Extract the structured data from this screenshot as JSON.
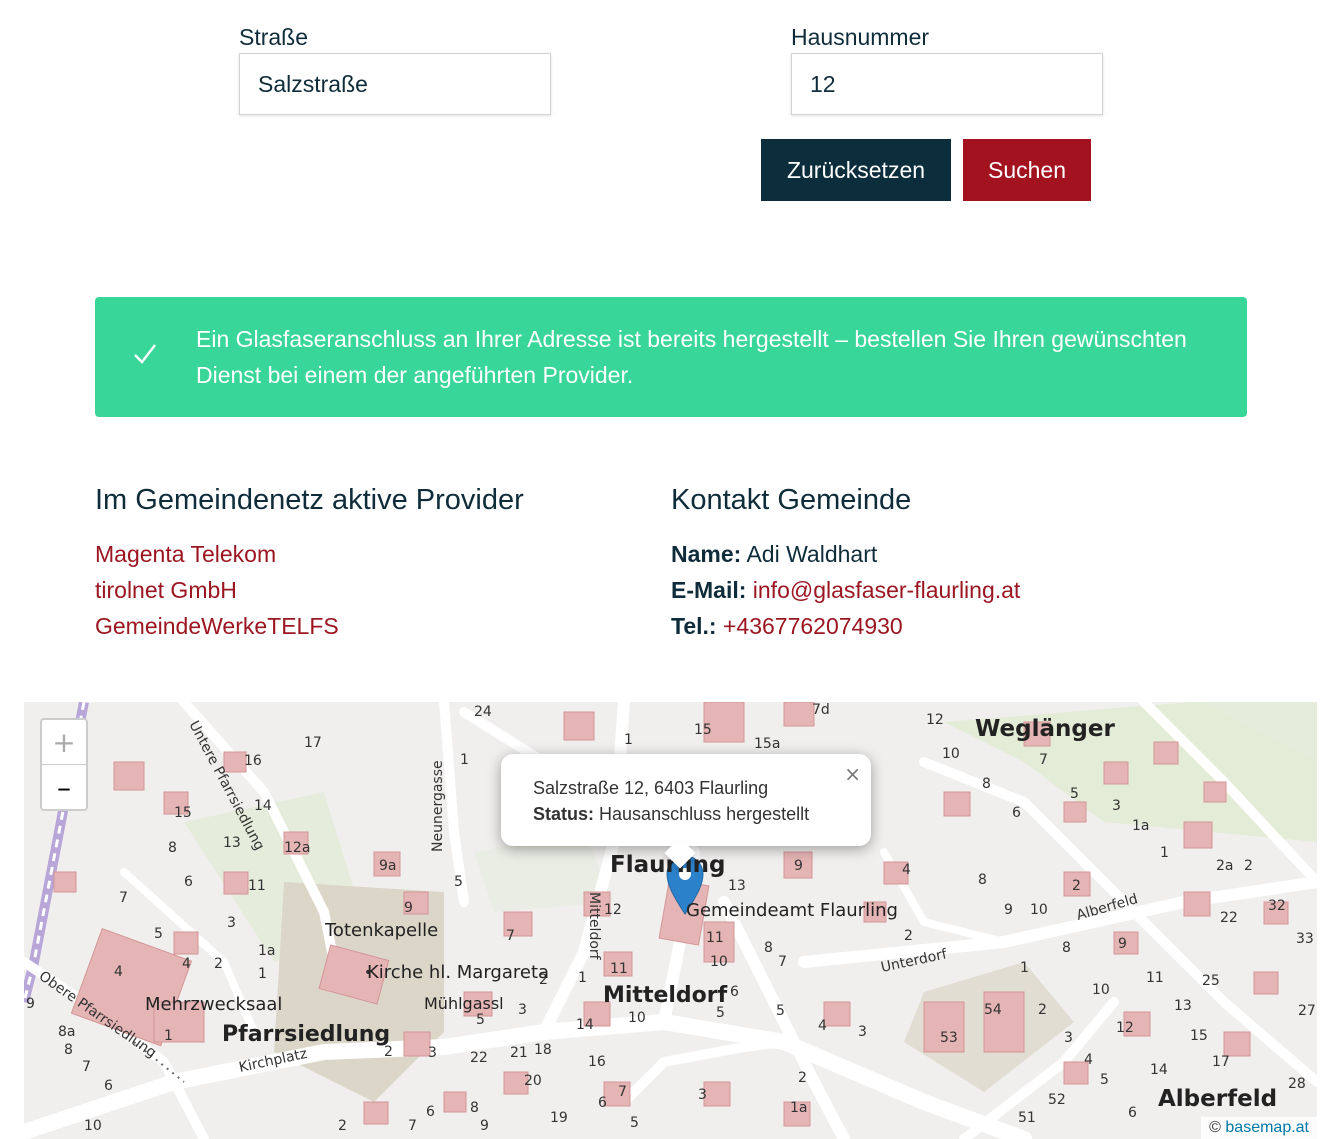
{
  "form": {
    "street_label": "Straße",
    "street_value": "Salzstraße",
    "number_label": "Hausnummer",
    "number_value": "12",
    "reset_label": "Zurücksetzen",
    "search_label": "Suchen"
  },
  "alert": {
    "icon": "check-icon",
    "text": "Ein Glasfaseranschluss an Ihrer Adresse ist bereits hergestellt – bestellen Sie Ihren gewünschten Dienst bei einem der angeführten Provider.",
    "color": "#38d698"
  },
  "providers": {
    "title": "Im Gemeindenetz aktive Provider",
    "items": [
      "Magenta Telekom",
      "tirolnet GmbH",
      "GemeindeWerkeTELFS"
    ]
  },
  "contact": {
    "title": "Kontakt Gemeinde",
    "name_label": "Name:",
    "name_value": "Adi Waldhart",
    "email_label": "E-Mail:",
    "email_value": "info@glasfaser-flaurling.at",
    "tel_label": "Tel.:",
    "tel_value": "+4367762074930"
  },
  "map": {
    "zoom_in": "+",
    "zoom_out": "–",
    "popup_address": "Salzstraße 12, 6403 Flaurling",
    "popup_status_label": "Status:",
    "popup_status_value": "Hausanschluss hergestellt",
    "popup_close": "×",
    "attribution_symbol": "©",
    "attribution_link": "basemap.at",
    "places": {
      "weglaenger": "Weglänger",
      "flaurling": "Flaurling",
      "mitteldorf": "Mitteldorf",
      "pfarrsiedlung": "Pfarrsiedlung",
      "alberfeld": "Alberfeld",
      "gemeindeamt": "Gemeindeamt Flaurling",
      "totenkapelle": "Totenkapelle",
      "kirche": "Kirche hl. Margareta",
      "mehrzwecksaal": "Mehrzwecksaal",
      "muehlgassl": "Mühlgassl",
      "unterdorf": "Unterdorf",
      "alberfeld_road": "Alberfeld",
      "kirchplatz": "Kirchplatz",
      "neunergasse": "Neunergasse",
      "mitteldorf_road": "Mitteldorf",
      "untere_pfarrsiedlung": "Untere Pfarrsiedlung",
      "obere_pfarrsiedlung": "Obere Pfarrsiedlung"
    }
  },
  "colors": {
    "primary_dark": "#0c2d3b",
    "accent_red": "#a3121f",
    "link_red": "#9b1621",
    "success_green": "#38d698"
  }
}
